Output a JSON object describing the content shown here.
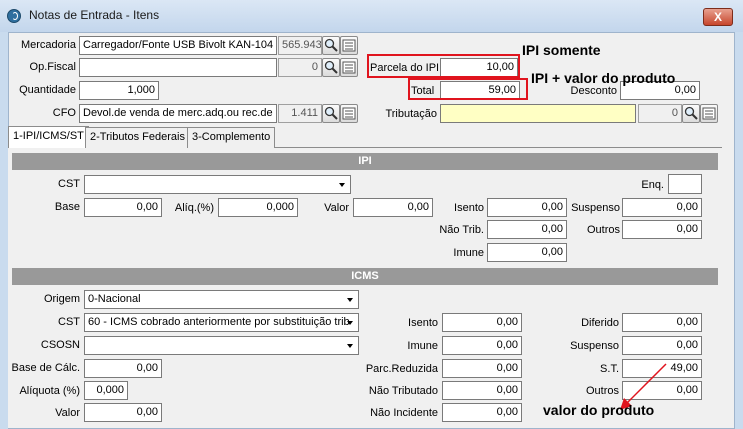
{
  "window": {
    "title": "Notas de Entrada - Itens",
    "close_label": "X"
  },
  "header": {
    "mercadoria_label": "Mercadoria",
    "mercadoria_value": "Carregador/Fonte USB Bivolt KAN-104 - ",
    "mercadoria_code": "565.943",
    "opfiscal_label": "Op.Fiscal",
    "opfiscal_value": "",
    "opfiscal_code": "0",
    "quantidade_label": "Quantidade",
    "quantidade_value": "1,000",
    "cfo_label": "CFO",
    "cfo_value": "Devol.de venda de merc.adq.ou rec.de",
    "cfo_code": "1.411",
    "parcela_label": "Parcela do IPI",
    "parcela_value": "10,00",
    "total_label": "Total",
    "total_value": "59,00",
    "desconto_label": "Desconto",
    "desconto_value": "0,00",
    "tributacao_label": "Tributação",
    "tributacao_value": "",
    "tributacao_code": "0"
  },
  "tabs": [
    "1-IPI/ICMS/ST",
    "2-Tributos Federais",
    "3-Complemento"
  ],
  "ipi": {
    "section_title": "IPI",
    "cst_label": "CST",
    "cst_value": "",
    "enq_label": "Enq.",
    "enq_value": "",
    "base_label": "Base",
    "base_value": "0,00",
    "aliq_label": "Alíq.(%)",
    "aliq_value": "0,000",
    "valor_label": "Valor",
    "valor_value": "0,00",
    "isento_label": "Isento",
    "isento_value": "0,00",
    "suspenso_label": "Suspenso",
    "suspenso_value": "0,00",
    "naotrib_label": "Não Trib.",
    "naotrib_value": "0,00",
    "outros_label": "Outros",
    "outros_value": "0,00",
    "imune_label": "Imune",
    "imune_value": "0,00"
  },
  "icms": {
    "section_title": "ICMS",
    "origem_label": "Origem",
    "origem_value": "0-Nacional",
    "cst_label": "CST",
    "cst_value": "60 - ICMS cobrado anteriormente por substituição trib",
    "csosn_label": "CSOSN",
    "csosn_value": "",
    "base_label": "Base de Cálc.",
    "base_value": "0,00",
    "aliq_label": "Alíquota (%)",
    "aliq_value": "0,000",
    "valor_label": "Valor",
    "valor_value": "0,00",
    "isento_label": "Isento",
    "isento_value": "0,00",
    "imune_label": "Imune",
    "imune_value": "0,00",
    "parcred_label": "Parc.Reduzida",
    "parcred_value": "0,00",
    "naotrib_label": "Não Tributado",
    "naotrib_value": "0,00",
    "naoinc_label": "Não Incidente",
    "naoinc_value": "0,00",
    "diferido_label": "Diferido",
    "diferido_value": "0,00",
    "suspenso_label": "Suspenso",
    "suspenso_value": "0,00",
    "st_label": "S.T.",
    "st_value": "49,00",
    "outros_label": "Outros",
    "outros_value": "0,00"
  },
  "annotations": {
    "ipi_somente": "IPI somente",
    "ipi_mais_produto": "IPI + valor do produto",
    "valor_produto": "valor do produto"
  },
  "colors": {
    "highlight": "#e0141e",
    "section_bar": "#999999"
  }
}
